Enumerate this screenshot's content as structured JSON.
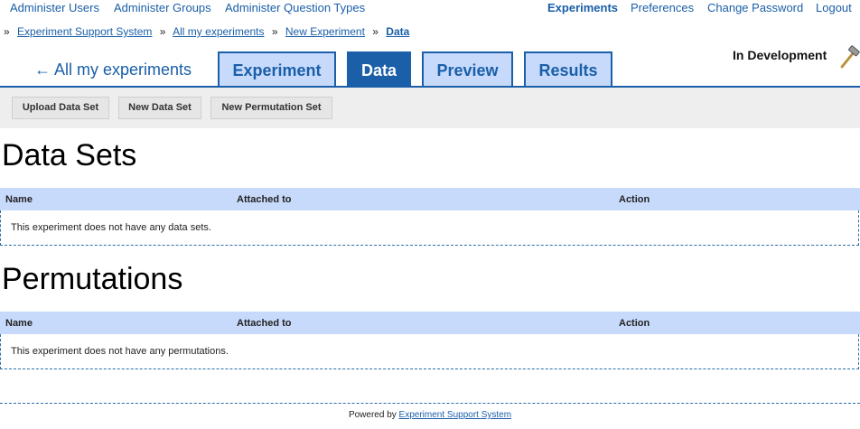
{
  "topnav": {
    "left": [
      "Administer Users",
      "Administer Groups",
      "Administer Question Types"
    ],
    "right": [
      "Experiments",
      "Preferences",
      "Change Password",
      "Logout"
    ]
  },
  "breadcrumb": {
    "prefix": "»",
    "items": [
      "Experiment Support System",
      "All my experiments",
      "New Experiment",
      "Data"
    ],
    "sep": "»"
  },
  "backlink": "← All my experiments",
  "tabs": [
    "Experiment",
    "Data",
    "Preview",
    "Results"
  ],
  "status": "In Development",
  "toolbar": [
    "Upload Data Set",
    "New Data Set",
    "New Permutation Set"
  ],
  "datasets": {
    "title": "Data Sets",
    "columns": [
      "Name",
      "Attached to",
      "Action"
    ],
    "empty": "This experiment does not have any data sets."
  },
  "permutations": {
    "title": "Permutations",
    "columns": [
      "Name",
      "Attached to",
      "Action"
    ],
    "empty": "This experiment does not have any permutations."
  },
  "footer": {
    "prefix": "Powered by",
    "link": "Experiment Support System"
  },
  "colors": {
    "accent": "#1a5fa8",
    "tab_bg": "#c8dafb",
    "toolbar_bg": "#eeeeee"
  },
  "icons": {
    "status": "hammer-icon"
  }
}
